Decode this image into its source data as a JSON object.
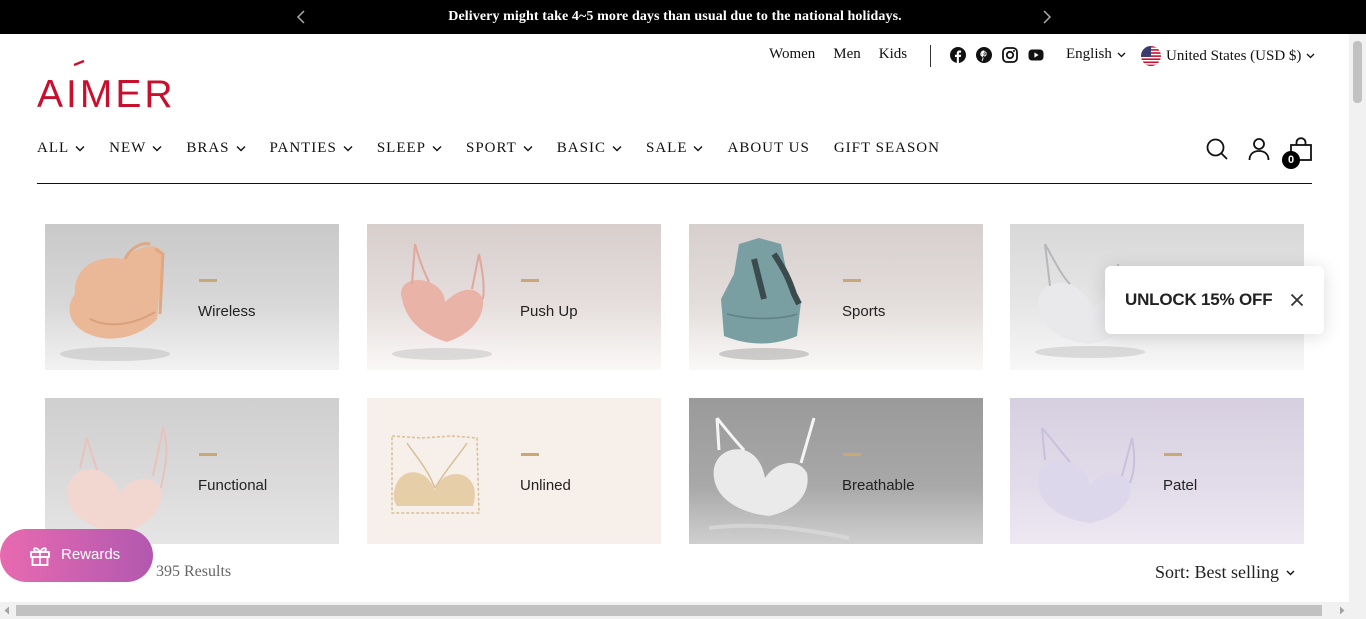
{
  "announcement": {
    "text": "Delivery might take 4~5 more days than usual due to the national holidays."
  },
  "utility": {
    "audience": [
      "Women",
      "Men",
      "Kids"
    ],
    "social": [
      "facebook-icon",
      "pinterest-icon",
      "instagram-icon",
      "youtube-icon"
    ],
    "language": "English",
    "country": "United States (USD $)"
  },
  "logo": {
    "text": "AIMER",
    "color": "#c8102e"
  },
  "nav": {
    "items": [
      {
        "label": "ALL",
        "dropdown": true
      },
      {
        "label": "NEW",
        "dropdown": true
      },
      {
        "label": "BRAS",
        "dropdown": true
      },
      {
        "label": "PANTIES",
        "dropdown": true
      },
      {
        "label": "SLEEP",
        "dropdown": true
      },
      {
        "label": "SPORT",
        "dropdown": true
      },
      {
        "label": "BASIC",
        "dropdown": true
      },
      {
        "label": "SALE",
        "dropdown": true
      },
      {
        "label": "ABOUT US",
        "dropdown": false
      },
      {
        "label": "GIFT SEASON",
        "dropdown": false
      }
    ]
  },
  "cart": {
    "count": "0"
  },
  "categories": [
    {
      "label": "Wireless"
    },
    {
      "label": "Push Up"
    },
    {
      "label": "Sports"
    },
    {
      "label": ""
    },
    {
      "label": "Functional"
    },
    {
      "label": "Unlined"
    },
    {
      "label": "Breathable"
    },
    {
      "label": "Patel"
    }
  ],
  "promo": {
    "text": "UNLOCK 15% OFF"
  },
  "rewards": {
    "label": "Rewards"
  },
  "listing": {
    "results": "395 Results",
    "sort": "Sort: Best selling"
  },
  "colors": {
    "accent": "#c8102e",
    "dash": "#c9a878",
    "rewards_start": "#e86ab0",
    "rewards_end": "#b258b0"
  }
}
